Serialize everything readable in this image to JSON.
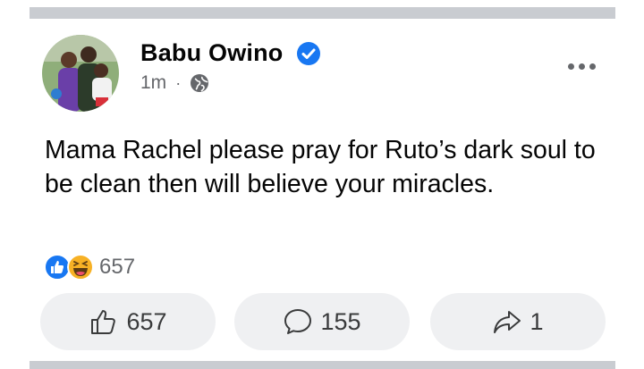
{
  "post": {
    "author": "Babu Owino",
    "verified": true,
    "time": "1m",
    "meta_separator": "·",
    "privacy_icon": "globe-icon",
    "text": "Mama Rachel please pray for Ruto’s dark soul to be clean then will believe your miracles."
  },
  "reactions": {
    "icons": [
      "like-reaction-icon",
      "haha-reaction-icon"
    ],
    "count": "657"
  },
  "actions": {
    "like_count": "657",
    "comment_count": "155",
    "share_count": "1"
  },
  "colors": {
    "verified": "#1877f2",
    "like_reaction": "#1877f2",
    "haha_reaction": "#f7b125",
    "button_bg": "#eff0f2",
    "meta_text": "#65676b",
    "separator": "#c9ccd1"
  }
}
